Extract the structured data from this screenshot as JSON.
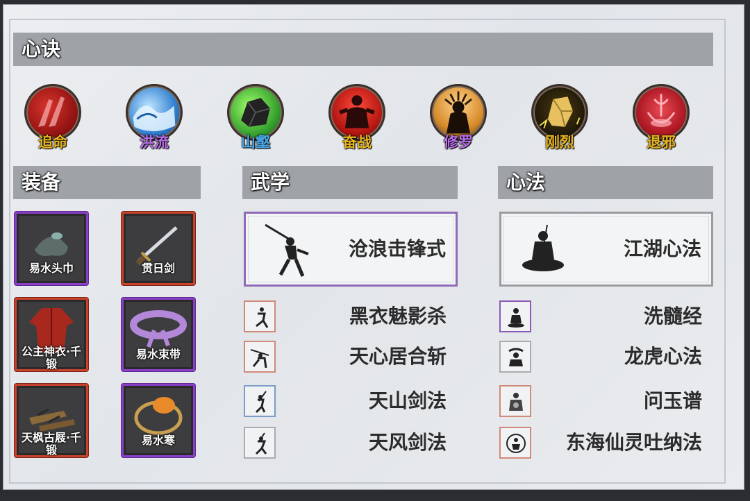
{
  "sections": {
    "xinjue": "心诀",
    "equipment": "装备",
    "wuxue": "武学",
    "xinfa": "心法"
  },
  "xinjue_items": [
    {
      "label": "追命",
      "icon": "red-slash-icon",
      "color": "#e8b41c"
    },
    {
      "label": "洪流",
      "icon": "water-wave-icon",
      "color": "#b86ee8"
    },
    {
      "label": "山壑",
      "icon": "rock-icon",
      "color": "#4aa8e8"
    },
    {
      "label": "奋战",
      "icon": "warrior-silhouette-icon",
      "color": "#e8b41c"
    },
    {
      "label": "修罗",
      "icon": "asura-silhouette-icon",
      "color": "#b86ee8"
    },
    {
      "label": "刚烈",
      "icon": "golden-crystal-icon",
      "color": "#e8b41c"
    },
    {
      "label": "退邪",
      "icon": "exorcism-emblem-icon",
      "color": "#e8b41c"
    }
  ],
  "equipment": [
    {
      "label": "易水头巾",
      "rarity": "purple",
      "icon": "headband-icon"
    },
    {
      "label": "贯日剑",
      "rarity": "red",
      "icon": "sword-icon"
    },
    {
      "label": "公主神衣·千锻",
      "rarity": "red",
      "icon": "robe-icon"
    },
    {
      "label": "易水束带",
      "rarity": "purple",
      "icon": "belt-icon"
    },
    {
      "label": "天枫古屐·千锻",
      "rarity": "red",
      "icon": "clogs-icon"
    },
    {
      "label": "易水寒",
      "rarity": "purple",
      "icon": "bracelet-icon"
    }
  ],
  "wuxue": {
    "main": {
      "label": "沧浪击锋式",
      "icon": "swordsman-icon"
    },
    "items": [
      {
        "label": "黑衣魅影杀",
        "icon": "assassin-icon",
        "border": "#d08a7a"
      },
      {
        "label": "天心居合斩",
        "icon": "iai-slash-icon",
        "border": "#d08a7a"
      },
      {
        "label": "天山剑法",
        "icon": "sword-dance-icon",
        "border": "#7b9bc8"
      },
      {
        "label": "天风剑法",
        "icon": "wind-sword-icon",
        "border": "#a9abaf"
      }
    ]
  },
  "xinfa": {
    "main": {
      "label": "江湖心法",
      "icon": "meditating-monk-icon"
    },
    "items": [
      {
        "label": "洗髓经",
        "icon": "monk-icon",
        "border": "#8a5ab8"
      },
      {
        "label": "龙虎心法",
        "icon": "dragon-tiger-icon",
        "border": "#a9abaf"
      },
      {
        "label": "问玉谱",
        "icon": "jade-icon",
        "border": "#d08a7a"
      },
      {
        "label": "东海仙灵吐纳法",
        "icon": "breathing-icon",
        "border": "#d08a7a"
      }
    ]
  }
}
